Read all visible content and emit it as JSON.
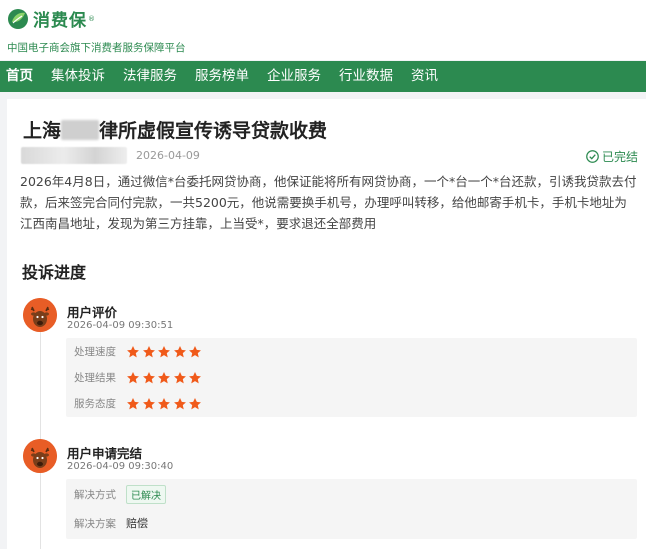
{
  "brand": {
    "name": "消费保",
    "reg_mark": "®",
    "tagline": "中国电子商会旗下消费者服务保障平台",
    "color": "#2c8a50"
  },
  "nav": {
    "items": [
      {
        "label": "首页",
        "active": true
      },
      {
        "label": "集体投诉"
      },
      {
        "label": "法律服务"
      },
      {
        "label": "服务榜单"
      },
      {
        "label": "企业服务"
      },
      {
        "label": "行业数据"
      },
      {
        "label": "资讯"
      }
    ]
  },
  "complaint": {
    "title_prefix": "上海",
    "title_suffix": "律所虚假宣传诱导贷款收费",
    "date": "2026-04-09",
    "status": "已完结",
    "status_icon": "check-circle-icon",
    "body": "2026年4月8日，通过微信*台委托网贷协商，他保证能将所有网贷协商，一个*台一个*台还款，引诱我贷款去付款，后来签完合同付完款，一共5200元，他说需要换手机号，办理呼叫转移，给他邮寄手机卡，手机卡地址为江西南昌地址，发现为第三方挂靠，上当受*，要求退还全部费用"
  },
  "progress": {
    "title": "投诉进度",
    "events": [
      {
        "title": "用户评价",
        "time": "2026-04-09 09:30:51",
        "avatar_icon": "reindeer-avatar-icon",
        "ratings": [
          {
            "label": "处理速度",
            "stars": 5
          },
          {
            "label": "处理结果",
            "stars": 5
          },
          {
            "label": "服务态度",
            "stars": 5
          }
        ]
      },
      {
        "title": "用户申请完结",
        "time": "2026-04-09 09:30:40",
        "avatar_icon": "reindeer-avatar-icon",
        "details": [
          {
            "label": "解决方式",
            "value": "已解决",
            "style": "tag"
          },
          {
            "label": "解决方案",
            "value": "赔偿",
            "style": "text"
          }
        ]
      }
    ]
  },
  "colors": {
    "accent": "#2c8a50",
    "star": "#f05a1a",
    "avatar_bg": "#e85d26"
  }
}
